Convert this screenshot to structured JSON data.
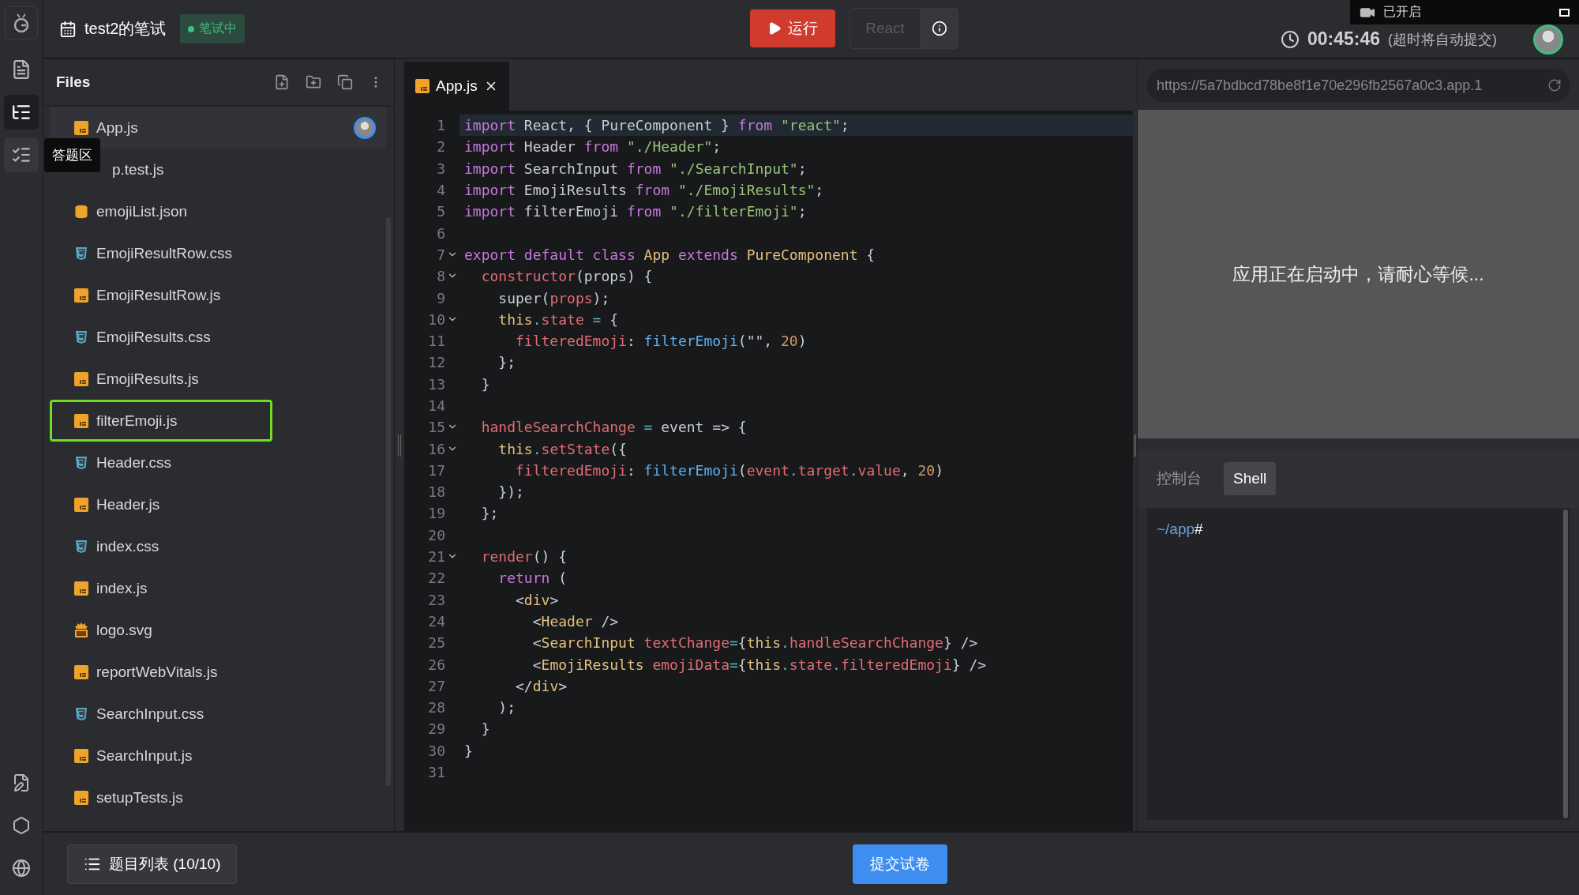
{
  "activity_bar": {
    "items": [
      {
        "kind": "document",
        "selected": false
      },
      {
        "kind": "tree",
        "selected": true
      },
      {
        "kind": "checklist",
        "selected": false,
        "tooltip": "答题区"
      }
    ],
    "bottom_items": [
      {
        "kind": "notes"
      },
      {
        "kind": "hexagon"
      },
      {
        "kind": "globe"
      }
    ]
  },
  "header": {
    "title": "test2的笔试",
    "status": "笔试中",
    "run_button": "运行",
    "framework": "React",
    "timer": "00:45:46",
    "timer_note": "(超时将自动提交)"
  },
  "recording": {
    "label": "已开启"
  },
  "files": {
    "title": "Files",
    "items": [
      {
        "name": "App.js",
        "kind": "js",
        "selected": true,
        "outlined": false
      },
      {
        "name": "p.test.js",
        "selected": false,
        "outlined": false
      },
      {
        "name": "emojiList.json",
        "kind": "json",
        "selected": false,
        "outlined": false
      },
      {
        "name": "EmojiResultRow.css",
        "kind": "css",
        "selected": false,
        "outlined": false
      },
      {
        "name": "EmojiResultRow.js",
        "kind": "js",
        "selected": false,
        "outlined": false
      },
      {
        "name": "EmojiResults.css",
        "kind": "css",
        "selected": false,
        "outlined": false
      },
      {
        "name": "EmojiResults.js",
        "kind": "js",
        "selected": false,
        "outlined": false
      },
      {
        "name": "filterEmoji.js",
        "kind": "js",
        "selected": false,
        "outlined": true
      },
      {
        "name": "Header.css",
        "kind": "css",
        "selected": false,
        "outlined": false
      },
      {
        "name": "Header.js",
        "kind": "js",
        "selected": false,
        "outlined": false
      },
      {
        "name": "index.css",
        "kind": "css",
        "selected": false,
        "outlined": false
      },
      {
        "name": "index.js",
        "kind": "js",
        "selected": false,
        "outlined": false
      },
      {
        "name": "logo.svg",
        "kind": "svg",
        "selected": false,
        "outlined": false
      },
      {
        "name": "reportWebVitals.js",
        "kind": "js",
        "selected": false,
        "outlined": false
      },
      {
        "name": "SearchInput.css",
        "kind": "css",
        "selected": false,
        "outlined": false
      },
      {
        "name": "SearchInput.js",
        "kind": "js",
        "selected": false,
        "outlined": false
      },
      {
        "name": "setupTests.js",
        "kind": "js",
        "selected": false,
        "outlined": false
      }
    ]
  },
  "editor": {
    "tabs": [
      {
        "label": "App.js",
        "selected": true
      }
    ],
    "lines": [
      {
        "number": "1",
        "current": true,
        "foldable": false,
        "tokens": [
          {
            "kind": "kw",
            "text": "import"
          },
          {
            "kind": "plain",
            "text": " React, { PureComponent } "
          },
          {
            "kind": "kw",
            "text": "from"
          },
          {
            "kind": "str",
            "text": " \"react\""
          },
          {
            "kind": "plain",
            "text": ";"
          }
        ]
      },
      {
        "number": "2",
        "current": false,
        "foldable": false,
        "tokens": [
          {
            "kind": "kw",
            "text": "import"
          },
          {
            "kind": "plain",
            "text": " Header "
          },
          {
            "kind": "kw",
            "text": "from"
          },
          {
            "kind": "str",
            "text": " \"./Header\""
          },
          {
            "kind": "plain",
            "text": ";"
          }
        ]
      },
      {
        "number": "3",
        "current": false,
        "foldable": false,
        "tokens": [
          {
            "kind": "kw",
            "text": "import"
          },
          {
            "kind": "plain",
            "text": " SearchInput "
          },
          {
            "kind": "kw",
            "text": "from"
          },
          {
            "kind": "str",
            "text": " \"./SearchInput\""
          },
          {
            "kind": "plain",
            "text": ";"
          }
        ]
      },
      {
        "number": "4",
        "current": false,
        "foldable": false,
        "tokens": [
          {
            "kind": "kw",
            "text": "import"
          },
          {
            "kind": "plain",
            "text": " EmojiResults "
          },
          {
            "kind": "kw",
            "text": "from"
          },
          {
            "kind": "str",
            "text": " \"./EmojiResults\""
          },
          {
            "kind": "plain",
            "text": ";"
          }
        ]
      },
      {
        "number": "5",
        "current": false,
        "foldable": false,
        "tokens": [
          {
            "kind": "kw",
            "text": "import"
          },
          {
            "kind": "plain",
            "text": " filterEmoji "
          },
          {
            "kind": "kw",
            "text": "from"
          },
          {
            "kind": "str",
            "text": " \"./filterEmoji\""
          },
          {
            "kind": "plain",
            "text": ";"
          }
        ]
      },
      {
        "number": "6",
        "current": false,
        "foldable": false
      },
      {
        "number": "7",
        "current": false,
        "foldable": true,
        "tokens": [
          {
            "kind": "kw",
            "text": "export default class "
          },
          {
            "kind": "type",
            "text": "App"
          },
          {
            "kind": "kw",
            "text": " extends "
          },
          {
            "kind": "type",
            "text": "PureComponent"
          },
          {
            "kind": "plain",
            "text": " {"
          }
        ]
      },
      {
        "number": "8",
        "current": false,
        "foldable": true,
        "tokens": [
          {
            "kind": "var",
            "text": "  constructor"
          },
          {
            "kind": "plain",
            "text": "(props) {"
          }
        ]
      },
      {
        "number": "9",
        "current": false,
        "foldable": false,
        "tokens": [
          {
            "kind": "plain",
            "text": "    super("
          },
          {
            "kind": "var",
            "text": "props"
          },
          {
            "kind": "plain",
            "text": ");"
          }
        ]
      },
      {
        "number": "10",
        "current": false,
        "foldable": true,
        "tokens": [
          {
            "kind": "type",
            "text": "    this"
          },
          {
            "kind": "op",
            "text": "."
          },
          {
            "kind": "var",
            "text": "state"
          },
          {
            "kind": "op",
            "text": " ="
          },
          {
            "kind": "plain",
            "text": " {"
          }
        ]
      },
      {
        "number": "11",
        "current": false,
        "foldable": false,
        "tokens": [
          {
            "kind": "var",
            "text": "      filteredEmoji"
          },
          {
            "kind": "plain",
            "text": ": "
          },
          {
            "kind": "fn",
            "text": "filterEmoji"
          },
          {
            "kind": "plain",
            "text": "(\"\", "
          },
          {
            "kind": "num",
            "text": "20"
          },
          {
            "kind": "plain",
            "text": ")"
          }
        ]
      },
      {
        "number": "12",
        "current": false,
        "foldable": false,
        "tokens": [
          {
            "kind": "plain",
            "text": "    };"
          }
        ]
      },
      {
        "number": "13",
        "current": false,
        "foldable": false,
        "tokens": [
          {
            "kind": "plain",
            "text": "  }"
          }
        ]
      },
      {
        "number": "14",
        "current": false,
        "foldable": false
      },
      {
        "number": "15",
        "current": false,
        "foldable": true,
        "tokens": [
          {
            "kind": "var",
            "text": "  handleSearchChange"
          },
          {
            "kind": "op",
            "text": " ="
          },
          {
            "kind": "plain",
            "text": " event => {"
          }
        ]
      },
      {
        "number": "16",
        "current": false,
        "foldable": true,
        "tokens": [
          {
            "kind": "type",
            "text": "    this"
          },
          {
            "kind": "op",
            "text": "."
          },
          {
            "kind": "var",
            "text": "setState"
          },
          {
            "kind": "plain",
            "text": "({"
          }
        ]
      },
      {
        "number": "17",
        "current": false,
        "foldable": false,
        "tokens": [
          {
            "kind": "var",
            "text": "      filteredEmoji"
          },
          {
            "kind": "plain",
            "text": ": "
          },
          {
            "kind": "fn",
            "text": "filterEmoji"
          },
          {
            "kind": "plain",
            "text": "("
          },
          {
            "kind": "var",
            "text": "event"
          },
          {
            "kind": "op",
            "text": "."
          },
          {
            "kind": "var",
            "text": "target"
          },
          {
            "kind": "op",
            "text": "."
          },
          {
            "kind": "var",
            "text": "value"
          },
          {
            "kind": "plain",
            "text": ", "
          },
          {
            "kind": "num",
            "text": "20"
          },
          {
            "kind": "plain",
            "text": ")"
          }
        ]
      },
      {
        "number": "18",
        "current": false,
        "foldable": false,
        "tokens": [
          {
            "kind": "plain",
            "text": "    });"
          }
        ]
      },
      {
        "number": "19",
        "current": false,
        "foldable": false,
        "tokens": [
          {
            "kind": "plain",
            "text": "  };"
          }
        ]
      },
      {
        "number": "20",
        "current": false,
        "foldable": false
      },
      {
        "number": "21",
        "current": false,
        "foldable": true,
        "tokens": [
          {
            "kind": "var",
            "text": "  render"
          },
          {
            "kind": "plain",
            "text": "() {"
          }
        ]
      },
      {
        "number": "22",
        "current": false,
        "foldable": false,
        "tokens": [
          {
            "kind": "kw",
            "text": "    return"
          },
          {
            "kind": "plain",
            "text": " ("
          }
        ]
      },
      {
        "number": "23",
        "current": false,
        "foldable": false,
        "tokens": [
          {
            "kind": "plain",
            "text": "      <"
          },
          {
            "kind": "type",
            "text": "div"
          },
          {
            "kind": "plain",
            "text": ">"
          }
        ]
      },
      {
        "number": "24",
        "current": false,
        "foldable": false,
        "tokens": [
          {
            "kind": "plain",
            "text": "        <"
          },
          {
            "kind": "type",
            "text": "Header"
          },
          {
            "kind": "plain",
            "text": " />"
          }
        ]
      },
      {
        "number": "25",
        "current": false,
        "foldable": false,
        "tokens": [
          {
            "kind": "plain",
            "text": "        <"
          },
          {
            "kind": "type",
            "text": "SearchInput"
          },
          {
            "kind": "var",
            "text": " textChange"
          },
          {
            "kind": "op",
            "text": "="
          },
          {
            "kind": "plain",
            "text": "{"
          },
          {
            "kind": "type",
            "text": "this"
          },
          {
            "kind": "op",
            "text": "."
          },
          {
            "kind": "var",
            "text": "handleSearchChange"
          },
          {
            "kind": "plain",
            "text": "} />"
          }
        ]
      },
      {
        "number": "26",
        "current": false,
        "foldable": false,
        "tokens": [
          {
            "kind": "plain",
            "text": "        <"
          },
          {
            "kind": "type",
            "text": "EmojiResults"
          },
          {
            "kind": "var",
            "text": " emojiData"
          },
          {
            "kind": "op",
            "text": "="
          },
          {
            "kind": "plain",
            "text": "{"
          },
          {
            "kind": "type",
            "text": "this"
          },
          {
            "kind": "op",
            "text": "."
          },
          {
            "kind": "var",
            "text": "state"
          },
          {
            "kind": "op",
            "text": "."
          },
          {
            "kind": "var",
            "text": "filteredEmoji"
          },
          {
            "kind": "plain",
            "text": "} />"
          }
        ]
      },
      {
        "number": "27",
        "current": false,
        "foldable": false,
        "tokens": [
          {
            "kind": "plain",
            "text": "      </"
          },
          {
            "kind": "type",
            "text": "div"
          },
          {
            "kind": "plain",
            "text": ">"
          }
        ]
      },
      {
        "number": "28",
        "current": false,
        "foldable": false,
        "tokens": [
          {
            "kind": "plain",
            "text": "    );"
          }
        ]
      },
      {
        "number": "29",
        "current": false,
        "foldable": false,
        "tokens": [
          {
            "kind": "plain",
            "text": "  }"
          }
        ]
      },
      {
        "number": "30",
        "current": false,
        "foldable": false,
        "tokens": [
          {
            "kind": "plain",
            "text": "}"
          }
        ]
      },
      {
        "number": "31",
        "current": false,
        "foldable": false
      }
    ]
  },
  "preview": {
    "url": "https://5a7bdbcd78be8f1e70e296fb2567a0c3.app.1",
    "message": "应用正在启动中，请耐心等候..."
  },
  "console": {
    "tabs": [
      {
        "label": "控制台",
        "selected": false
      },
      {
        "label": "Shell",
        "selected": true
      }
    ],
    "prompt_path": "~/app",
    "prompt_symbol": "#"
  },
  "footer": {
    "question_list": "题目列表 (10/10)",
    "submit": "提交试卷"
  }
}
